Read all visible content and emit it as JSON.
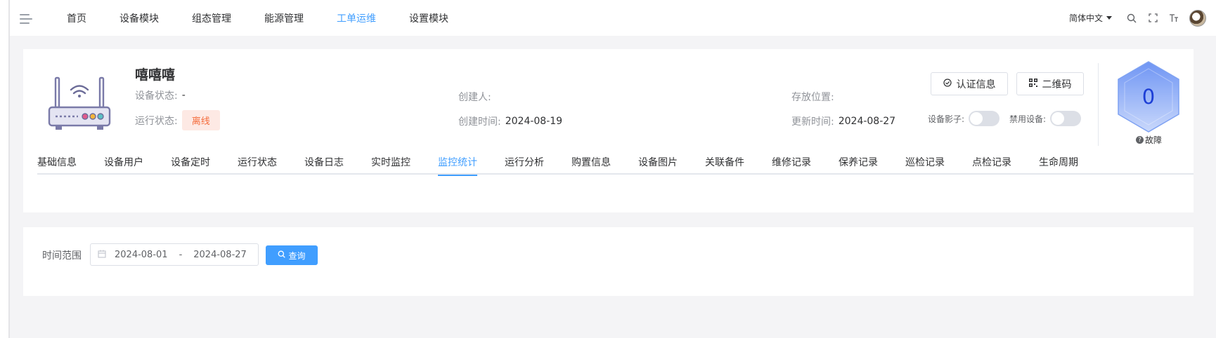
{
  "nav": {
    "items": [
      "首页",
      "设备模块",
      "组态管理",
      "能源管理",
      "工单运维",
      "设置模块"
    ],
    "active_index": 4
  },
  "header": {
    "language": "简体中文",
    "icons": [
      "search-icon",
      "fullscreen-icon",
      "font-size-icon",
      "avatar"
    ]
  },
  "device": {
    "name": "嘻嘻嘻",
    "status_label": "设备状态:",
    "status_value": "-",
    "run_label": "运行状态:",
    "run_value": "离线",
    "creator_label": "创建人:",
    "creator_value": "",
    "created_label": "创建时间:",
    "created_value": "2024-08-19",
    "location_label": "存放位置:",
    "location_value": "",
    "updated_label": "更新时间:",
    "updated_value": "2024-08-27"
  },
  "actions": {
    "cert_label": "认证信息",
    "qrcode_label": "二维码",
    "shadow_label": "设备影子:",
    "disable_label": "禁用设备:",
    "shadow_on": false,
    "disable_on": false
  },
  "fault": {
    "count": "0",
    "label": "故障"
  },
  "tabs": {
    "items": [
      "基础信息",
      "设备用户",
      "设备定时",
      "运行状态",
      "设备日志",
      "实时监控",
      "监控统计",
      "运行分析",
      "购置信息",
      "设备图片",
      "关联备件",
      "维修记录",
      "保养记录",
      "巡检记录",
      "点检记录",
      "生命周期"
    ],
    "active_index": 6
  },
  "filter": {
    "range_label": "时间范围",
    "start_date": "2024-08-01",
    "separator": "-",
    "end_date": "2024-08-27",
    "query_label": "查询"
  },
  "colors": {
    "accent": "#409eff",
    "offline_text": "#f56c3c",
    "offline_bg": "#fde9e4",
    "router": "#7a7aa8"
  }
}
